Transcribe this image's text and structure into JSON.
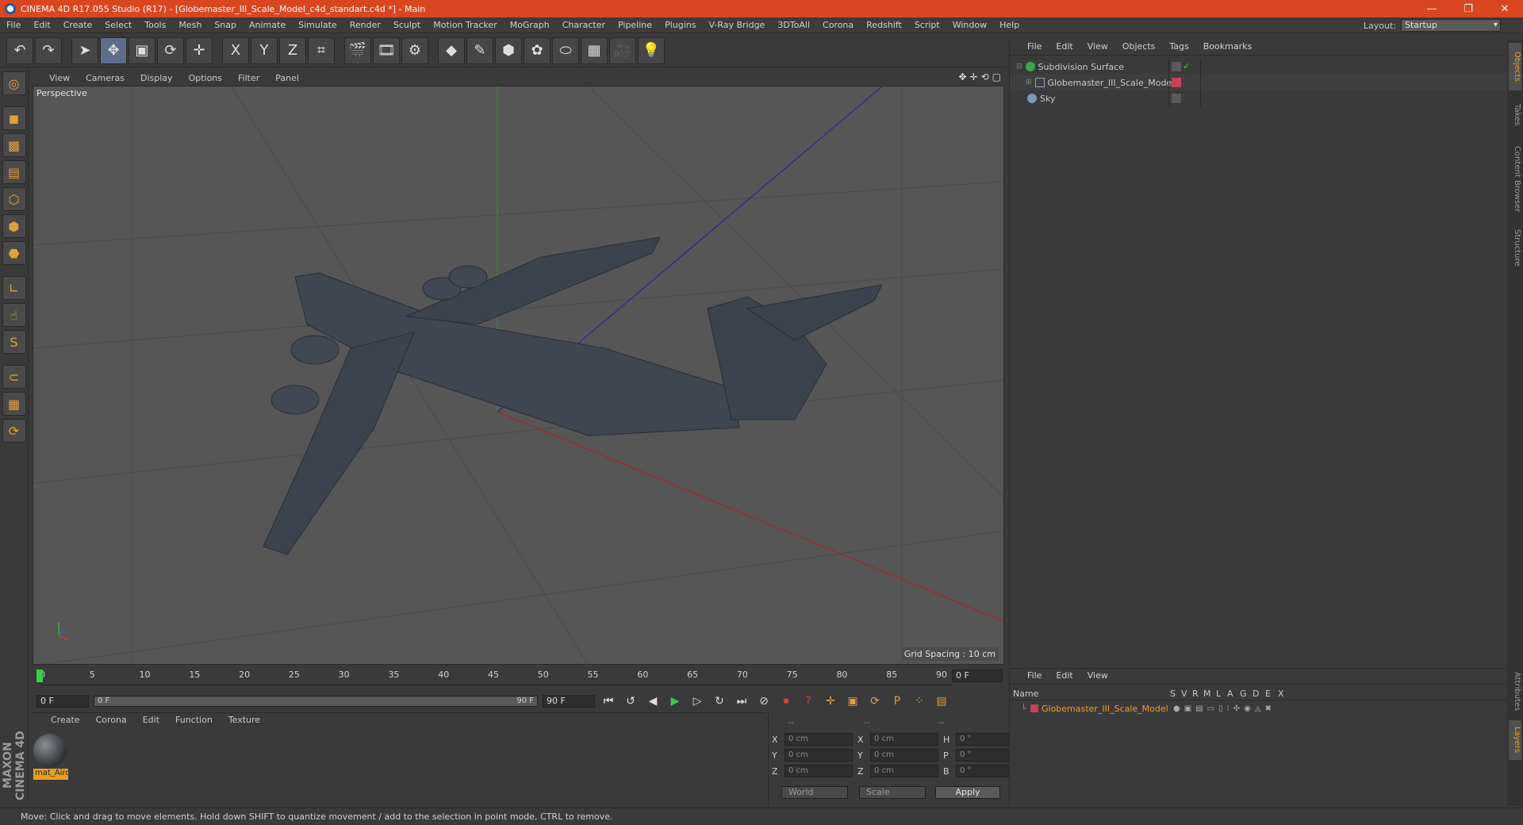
{
  "titlebar": {
    "title": "CINEMA 4D R17.055 Studio (R17) - [Globemaster_III_Scale_Model_c4d_standart.c4d *] - Main",
    "minimize": "—",
    "restore": "❐",
    "close": "✕"
  },
  "menubar": {
    "items": [
      "File",
      "Edit",
      "Create",
      "Select",
      "Tools",
      "Mesh",
      "Snap",
      "Animate",
      "Simulate",
      "Render",
      "Sculpt",
      "Motion Tracker",
      "MoGraph",
      "Character",
      "Pipeline",
      "Plugins",
      "V-Ray Bridge",
      "3DToAll",
      "Corona",
      "Redshift",
      "Script",
      "Window",
      "Help"
    ],
    "layout_label": "Layout:",
    "layout_value": "Startup"
  },
  "toolbar": {
    "icons": [
      "undo-icon",
      "redo-icon",
      "select-icon",
      "move-icon",
      "scale-icon",
      "rotate-icon",
      "transform-icon",
      "x-axis-icon",
      "y-axis-icon",
      "z-axis-icon",
      "coordinate-system-icon",
      "render-view-icon",
      "render-picture-viewer-icon",
      "edit-render-settings-icon",
      "cube-icon",
      "pen-icon",
      "subdivision-icon",
      "mograph-cloner-icon",
      "deformer-icon",
      "floor-icon",
      "camera-icon",
      "light-icon"
    ],
    "glyphs": [
      "↶",
      "↷",
      "➤",
      "✥",
      "▣",
      "⟳",
      "✛",
      "X",
      "Y",
      "Z",
      "⌗",
      "🎬",
      "🎞",
      "⚙",
      "◆",
      "✎",
      "⬢",
      "✿",
      "⬭",
      "▦",
      "🎥",
      "💡"
    ]
  },
  "lefttools": {
    "icons": [
      "make-editable-icon",
      "model-mode-icon",
      "texture-mode-icon",
      "workplane-icon",
      "points-mode-icon",
      "edges-mode-icon",
      "polygons-mode-icon",
      "axis-mode-icon",
      "tweak-mode-icon",
      "solo-icon",
      "snap-icon",
      "grid-lock-icon",
      "sculpt-lock-icon"
    ],
    "glyphs": [
      "◎",
      "◼",
      "▩",
      "▤",
      "⬡",
      "⬢",
      "⬣",
      "∟",
      "☝",
      "S",
      "⊂",
      "▦",
      "⟳"
    ]
  },
  "brand": "MAXON CINEMA 4D",
  "viewport": {
    "menu": [
      "View",
      "Cameras",
      "Display",
      "Options",
      "Filter",
      "Panel"
    ],
    "nav_icons": [
      "✥",
      "✛",
      "⟲",
      "▢"
    ],
    "label": "Perspective",
    "grid_spacing": "Grid Spacing : 10 cm"
  },
  "timeline": {
    "ticks": [
      "0",
      "5",
      "10",
      "15",
      "20",
      "25",
      "30",
      "35",
      "40",
      "45",
      "50",
      "55",
      "60",
      "65",
      "70",
      "75",
      "80",
      "85",
      "90"
    ],
    "current_frame": "0 F"
  },
  "playbar": {
    "start_frame": "0 F",
    "slider_start": "0 F",
    "slider_end": "90 F",
    "end_frame": "90 F"
  },
  "material_panel": {
    "menu": [
      "Create",
      "Corona",
      "Edit",
      "Function",
      "Texture"
    ],
    "material_name": "mat_Aircraft"
  },
  "coord_panel": {
    "header_dashes": [
      "--",
      "--",
      "--"
    ],
    "rows": [
      {
        "a": "X",
        "av": "0 cm",
        "b": "X",
        "bv": "0 cm",
        "c": "H",
        "cv": "0 °"
      },
      {
        "a": "Y",
        "av": "0 cm",
        "b": "Y",
        "bv": "0 cm",
        "c": "P",
        "cv": "0 °"
      },
      {
        "a": "Z",
        "av": "0 cm",
        "b": "Z",
        "bv": "0 cm",
        "c": "B",
        "cv": "0 °"
      }
    ],
    "world": "World",
    "scale": "Scale",
    "apply": "Apply"
  },
  "object_manager": {
    "menu": [
      "File",
      "Edit",
      "View",
      "Objects",
      "Tags",
      "Bookmarks"
    ],
    "objects": [
      {
        "name": "Subdivision Surface",
        "color": "#3aa84a"
      },
      {
        "name": "Globemaster_III_Scale_Model",
        "color": "#8aa0c0"
      },
      {
        "name": "Sky",
        "color": "#7a9ac0"
      }
    ]
  },
  "layer_manager": {
    "menu": [
      "File",
      "Edit",
      "View"
    ],
    "columns": [
      "Name",
      "S",
      "V",
      "R",
      "M",
      "L",
      "A",
      "G",
      "D",
      "E",
      "X"
    ],
    "layer_name": "Globemaster_III_Scale_Model"
  },
  "right_tabs": [
    "Objects",
    "Takes",
    "Content Browser",
    "Structure",
    "Attributes",
    "Layers"
  ],
  "status": "Move: Click and drag to move elements. Hold down SHIFT to quantize movement / add to the selection in point mode, CTRL to remove.",
  "colors": {
    "accent": "#d9461f",
    "highlight": "#e8a020",
    "play": "#3ad046",
    "record": "#e24030"
  }
}
